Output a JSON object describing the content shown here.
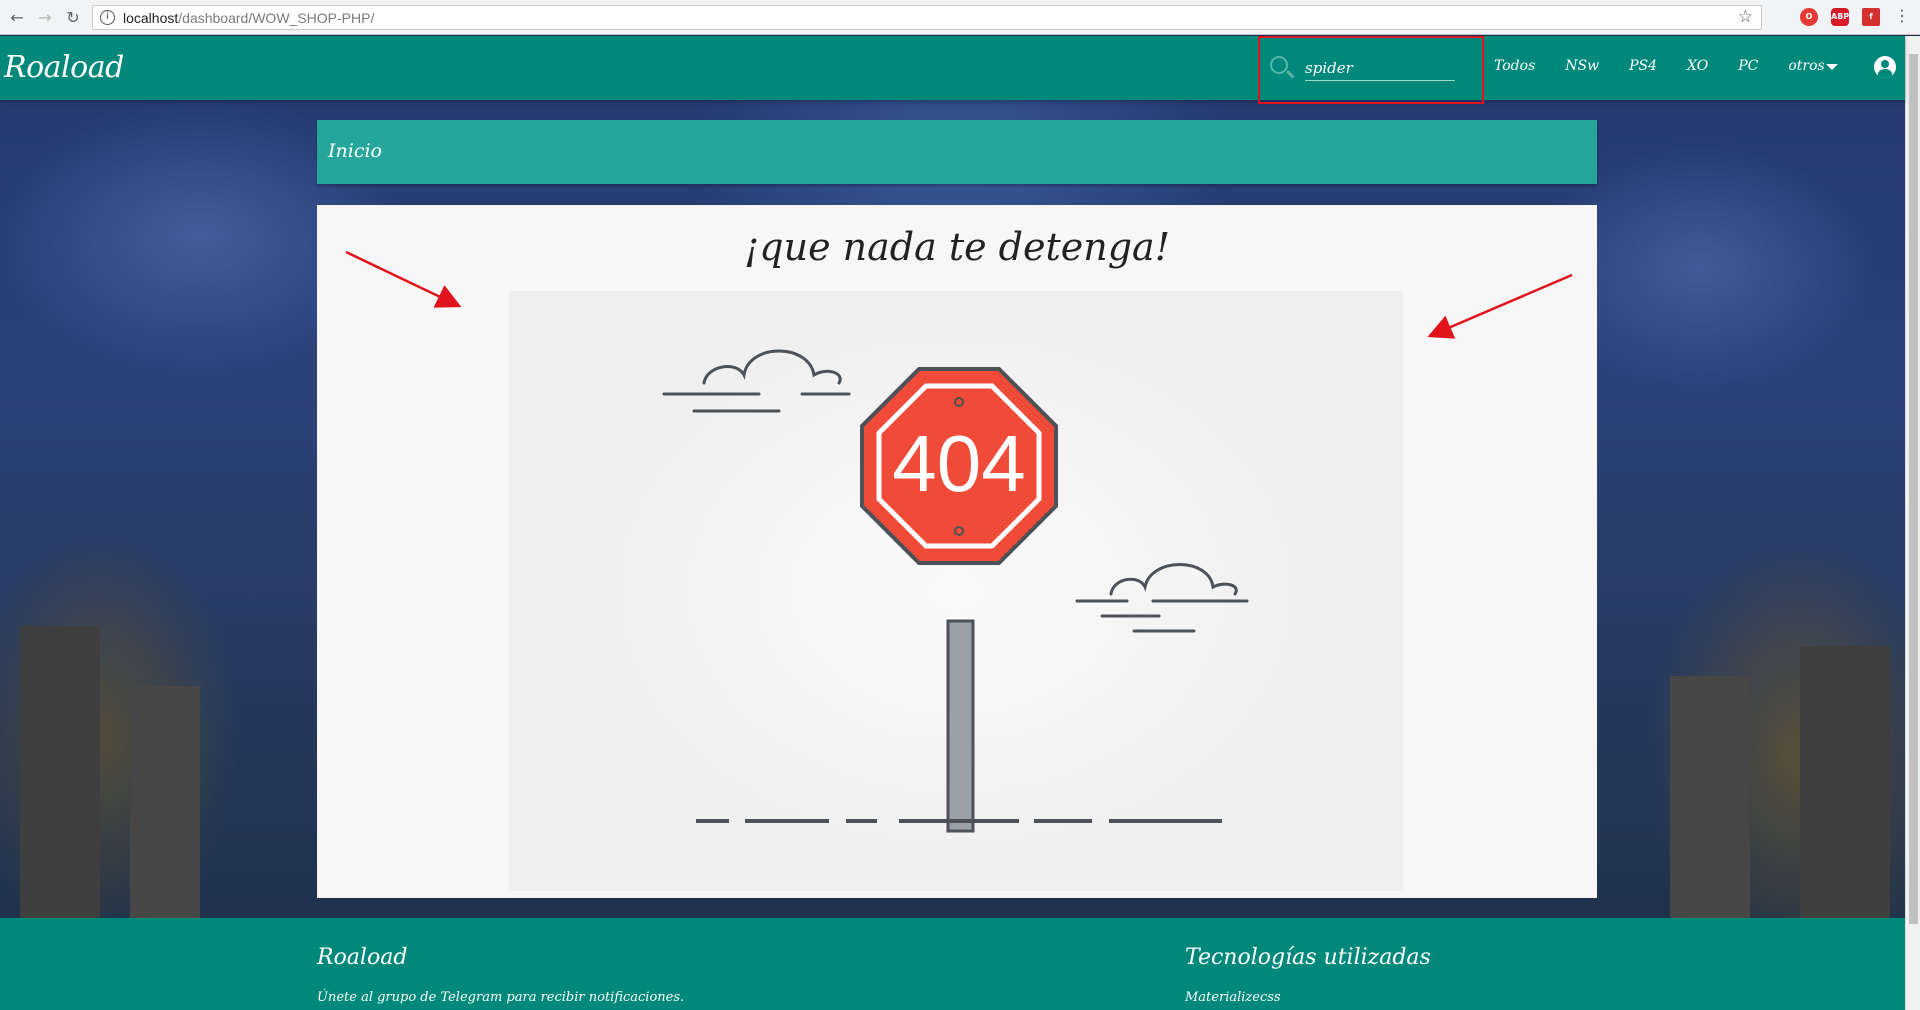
{
  "browser": {
    "url_host": "localhost",
    "url_path": "/dashboard/WOW_SHOP-PHP/",
    "extensions": [
      "opera-icon",
      "adblock-icon",
      "flash-icon"
    ],
    "ext_labels": [
      "",
      "ABP",
      ""
    ]
  },
  "navbar": {
    "brand": "Roaload",
    "search_value": "spider",
    "links": [
      "Todos",
      "NSw",
      "PS4",
      "XO",
      "PC",
      "otros"
    ]
  },
  "breadcrumb": {
    "label": "Inicio"
  },
  "card": {
    "title": "¡que nada te detenga!",
    "sign_text": "404"
  },
  "footer": {
    "left_title": "Roaload",
    "left_text": "Únete al grupo de Telegram para recibir notificaciones.",
    "right_title": "Tecnologías utilizadas",
    "right_text": "Materializecss"
  },
  "colors": {
    "primary": "#00897b",
    "secondary": "#26a69a",
    "sign_red": "#f04a38",
    "annotation": "#e0141c"
  }
}
